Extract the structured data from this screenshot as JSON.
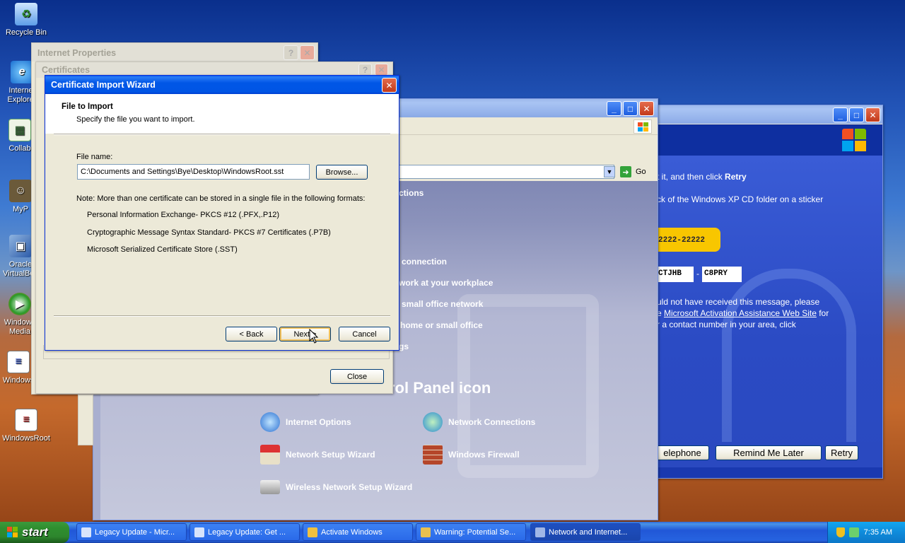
{
  "desktop": {
    "icons": [
      {
        "label": "Recycle Bin"
      },
      {
        "label": "Internet Explorer"
      },
      {
        "label": "Collab"
      },
      {
        "label": "MyP"
      },
      {
        "label": "Oracle VirtualBox"
      },
      {
        "label": "Windows Media Player"
      },
      {
        "label": "Windows"
      },
      {
        "label": "WindowsRoot"
      }
    ]
  },
  "activation": {
    "line1_prefix": "t it, and then click ",
    "line1_bold": "Retry",
    "line2": "ck of the Windows XP CD folder on a sticker",
    "product_key_tail": "2222-22222",
    "code_a": "CTJHB",
    "dash": "-",
    "code_b": "C8PRY",
    "para1": "uld not have received this message, please",
    "para2_prefix": "e ",
    "para2_link": "Microsoft Activation Assistance Web Site",
    "para2_suffix": " for",
    "para3": "r a contact number in your area, click",
    "btn_telephone": "elephone",
    "btn_remind": "Remind Me Later",
    "btn_retry": "Retry"
  },
  "network_cp": {
    "go_label": "Go",
    "header": "ctions",
    "tasks": [
      "connection",
      "work at your workplace",
      "small office network",
      "home or small office",
      "gs"
    ],
    "pick_icon_heading": "rol Panel icon",
    "items": [
      {
        "label": "Internet Options",
        "icon": "internet-options-icon"
      },
      {
        "label": "Network Connections",
        "icon": "network-connections-icon"
      },
      {
        "label": "Network Setup Wizard",
        "icon": "network-setup-icon"
      },
      {
        "label": "Windows Firewall",
        "icon": "firewall-icon"
      },
      {
        "label": "Wireless Network Setup Wizard",
        "icon": "wireless-icon"
      }
    ]
  },
  "internet_properties": {
    "title": "Internet Properties",
    "close_label": "Close"
  },
  "certificates": {
    "title": "Certificates"
  },
  "wizard": {
    "title": "Certificate Import Wizard",
    "header_title": "File to Import",
    "header_sub": "Specify the file you want to import.",
    "file_label": "File name:",
    "file_value": "C:\\Documents and Settings\\Bye\\Desktop\\WindowsRoot.sst",
    "browse_label": "Browse...",
    "note": "Note:  More than one certificate can be stored in a single file in the following formats:",
    "formats": [
      "Personal Information Exchange- PKCS #12 (.PFX,.P12)",
      "Cryptographic Message Syntax Standard- PKCS #7 Certificates (.P7B)",
      "Microsoft Serialized Certificate Store (.SST)"
    ],
    "back_label": "< Back",
    "next_label": "Next >",
    "cancel_label": "Cancel"
  },
  "taskbar": {
    "start_label": "start",
    "tasks": [
      {
        "label": "Legacy Update - Micr..."
      },
      {
        "label": "Legacy Update: Get ..."
      },
      {
        "label": "Activate Windows"
      },
      {
        "label": "Warning: Potential Se..."
      },
      {
        "label": "Network and Internet..."
      }
    ],
    "clock": "7:35 AM"
  }
}
